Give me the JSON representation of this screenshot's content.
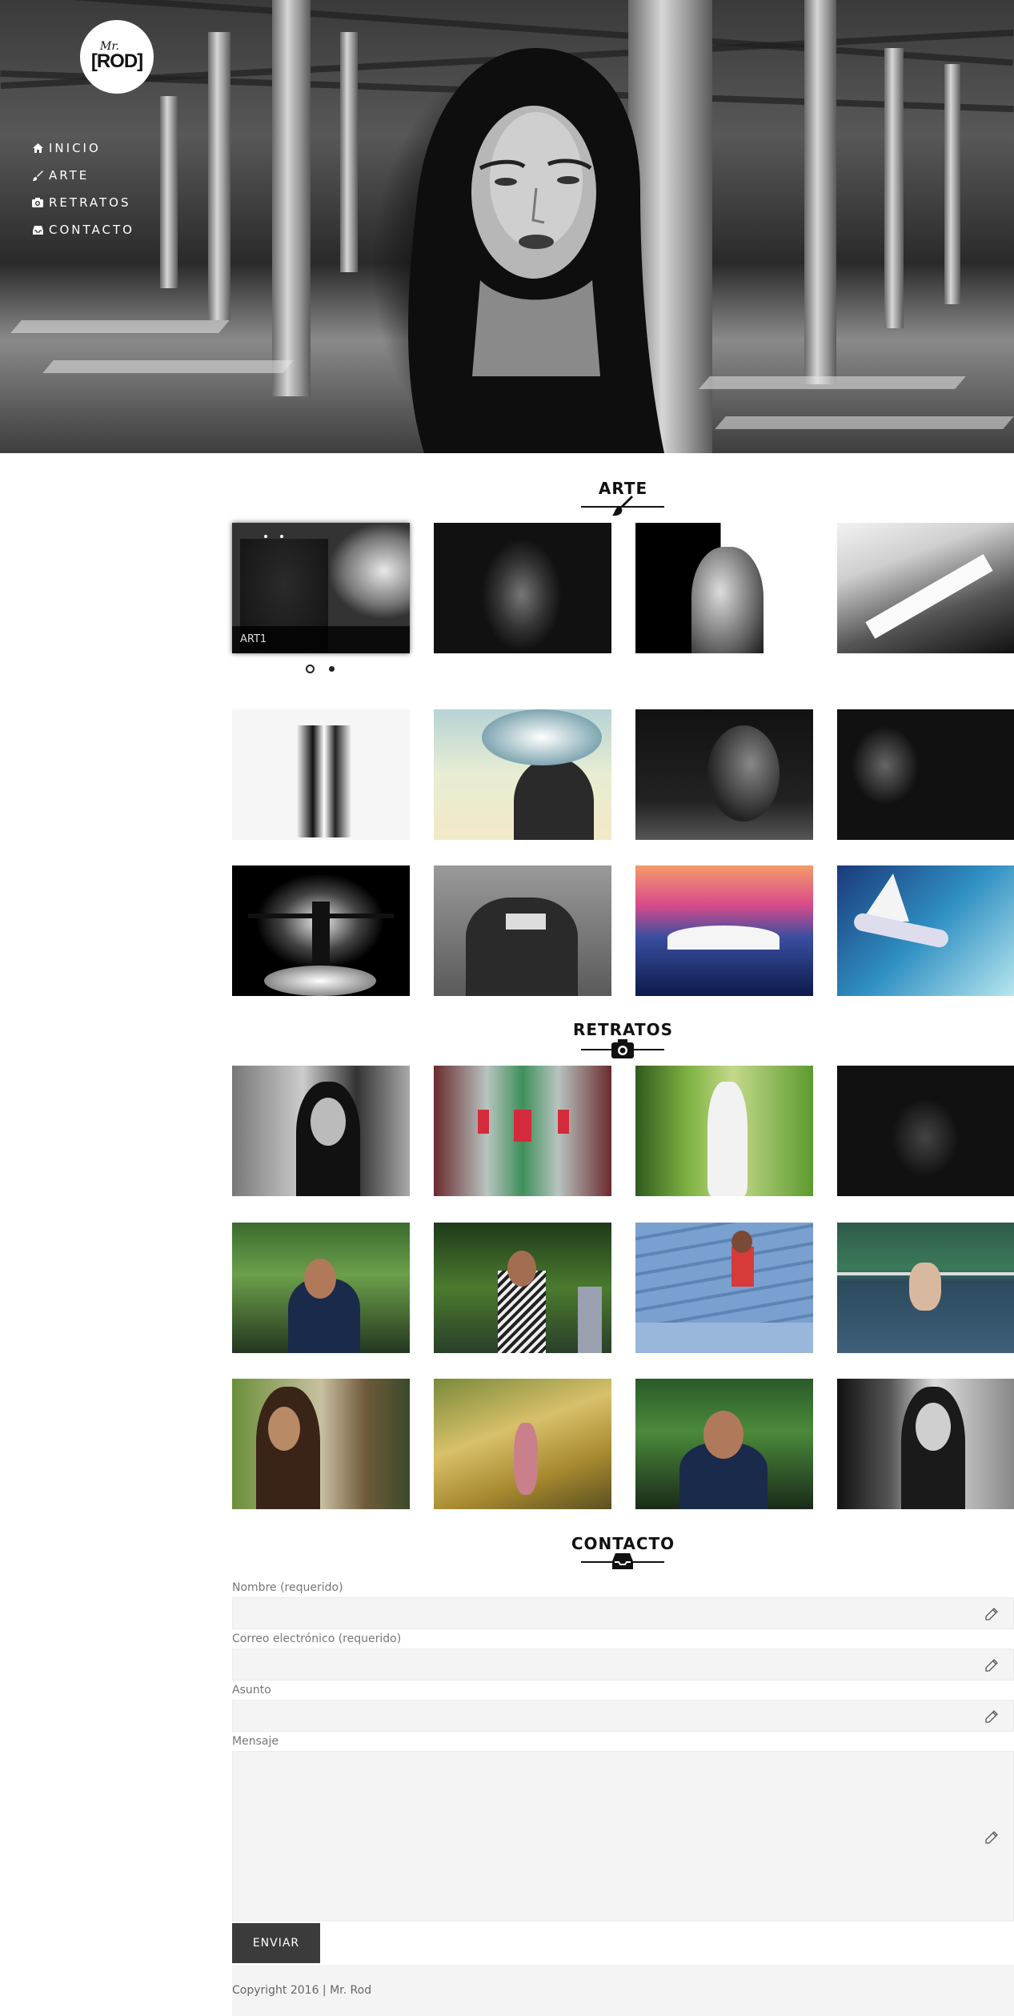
{
  "logo": {
    "line1": "Mr.",
    "line2": "[ROD]"
  },
  "nav": [
    {
      "label": "INICIO",
      "icon": "home-icon"
    },
    {
      "label": "ARTE",
      "icon": "brush-icon"
    },
    {
      "label": "RETRATOS",
      "icon": "camera-icon"
    },
    {
      "label": "CONTACTO",
      "icon": "inbox-icon"
    }
  ],
  "sections": {
    "arte": {
      "title": "ARTE",
      "icon": "brush-icon"
    },
    "retratos": {
      "title": "RETRATOS",
      "icon": "camera-icon"
    },
    "contacto": {
      "title": "CONTACTO",
      "icon": "inbox-icon"
    }
  },
  "arte": {
    "featured_caption": "ART1",
    "carousel_dots": 2,
    "active_dot": 1
  },
  "form": {
    "nombre_label": "Nombre (requerido)",
    "correo_label": "Correo electrónico (requerido)",
    "asunto_label": "Asunto",
    "mensaje_label": "Mensaje",
    "submit_label": "ENVIAR"
  },
  "footer": {
    "text": "Copyright 2016 | Mr. Rod"
  }
}
